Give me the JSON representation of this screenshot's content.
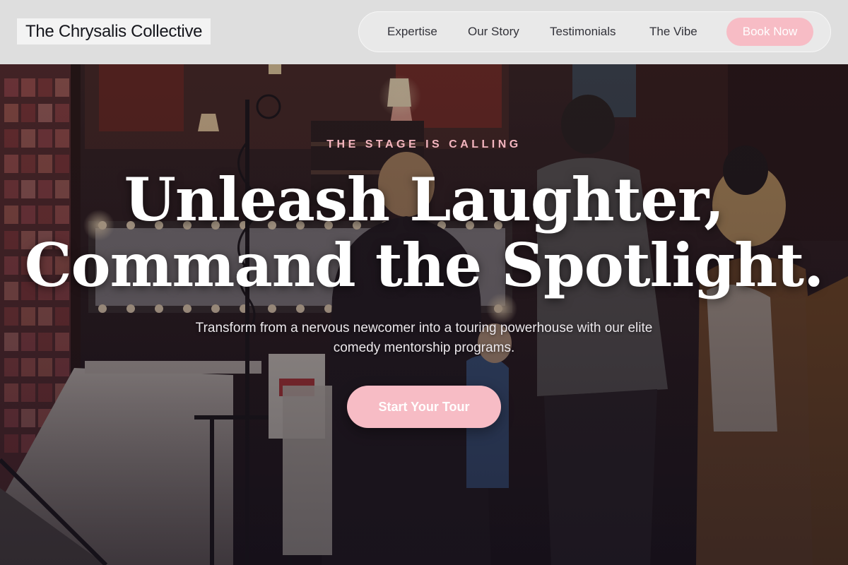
{
  "header": {
    "brand": "The Chrysalis Collective",
    "nav": {
      "items": [
        {
          "label": "Expertise"
        },
        {
          "label": "Our Story"
        },
        {
          "label": "Testimonials"
        },
        {
          "label": "The Vibe"
        }
      ],
      "cta_label": "Book Now"
    }
  },
  "hero": {
    "eyebrow": "THE STAGE IS CALLING",
    "headline_line1": "Unleash Laughter,",
    "headline_line2": "Command the Spotlight.",
    "subtext": "Transform from a nervous newcomer into a touring powerhouse with our elite comedy mentorship programs.",
    "cta_label": "Start Your Tour",
    "background": "photo of a crowded comedy club stairway with marquee sign"
  },
  "colors": {
    "accent_pink": "#f7bcc5",
    "eyebrow_pink": "#f4b5bf",
    "header_bg": "#dedede",
    "text_dark": "#15161c"
  }
}
